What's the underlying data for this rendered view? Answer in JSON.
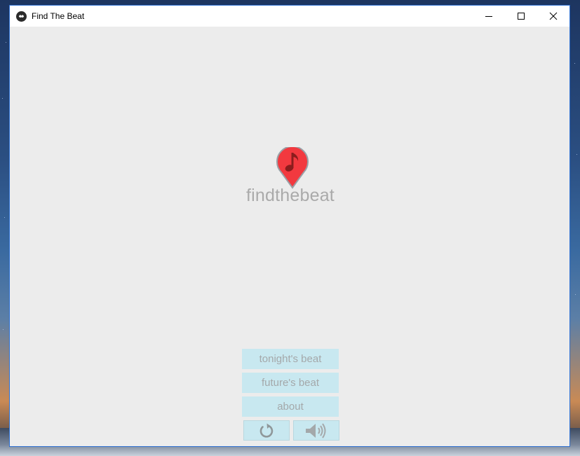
{
  "window": {
    "title": "Find The Beat"
  },
  "logo": {
    "text": "findthebeat",
    "pin_color": "#f2393f",
    "note_color": "#8b1d1d"
  },
  "menu": [
    {
      "label": "tonight's beat"
    },
    {
      "label": "future's beat"
    },
    {
      "label": "about"
    }
  ],
  "icons": {
    "refresh": "refresh-icon",
    "sound": "speaker-icon",
    "minimize": "minimize-icon",
    "maximize": "maximize-icon",
    "close": "close-icon"
  },
  "colors": {
    "button_bg": "#c8e8f0",
    "button_text": "#a4a8aa",
    "window_bg": "#ececec"
  }
}
